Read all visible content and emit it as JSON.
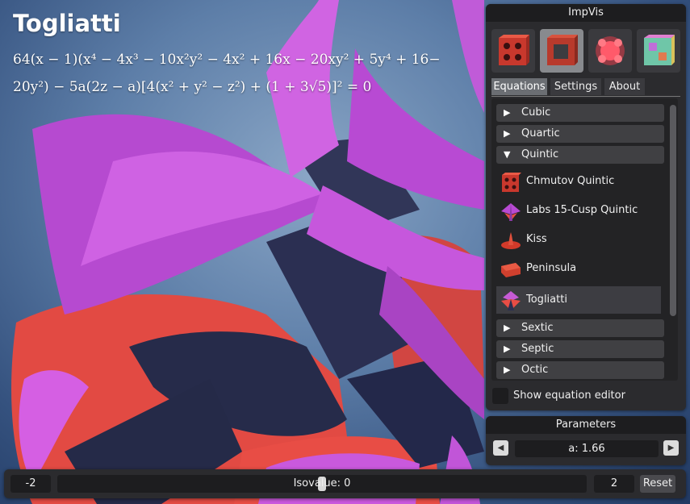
{
  "surface": {
    "title": "Togliatti",
    "equation_line1": "64(x − 1)(x⁴ − 4x³ − 10x²y² − 4x² + 16x − 20xy² + 5y⁴ + 16−",
    "equation_line2": "20y²) − 5a(2z − a)[4(x² + y² − z²) + (1 + 3√5)]² = 0",
    "colors": {
      "outer": "#c65bd6",
      "inner": "#e84d45",
      "background": "#5d7ea8"
    }
  },
  "panel": {
    "title": "ImpVis",
    "thumbnails": [
      {
        "name": "cube-wireframe-red",
        "selected": false
      },
      {
        "name": "cube-wireframe-dark",
        "selected": true
      },
      {
        "name": "glow-blob-red",
        "selected": false
      },
      {
        "name": "cube-rainbow",
        "selected": false
      }
    ],
    "tabs": {
      "equations": "Equations",
      "settings": "Settings",
      "about": "About",
      "active": "Equations"
    },
    "categories": {
      "cubic": "Cubic",
      "quartic": "Quartic",
      "quintic": "Quintic",
      "sextic": "Sextic",
      "septic": "Septic",
      "octic": "Octic"
    },
    "quintic_items": [
      {
        "label": "Chmutov Quintic",
        "icon": "chmutov-icon"
      },
      {
        "label": "Labs 15-Cusp Quintic",
        "icon": "labs-icon"
      },
      {
        "label": "Kiss",
        "icon": "kiss-icon"
      },
      {
        "label": "Peninsula",
        "icon": "peninsula-icon"
      },
      {
        "label": "Togliatti",
        "icon": "togliatti-icon",
        "selected": true
      }
    ],
    "editor_checkbox": {
      "label": "Show equation editor",
      "checked": false
    }
  },
  "parameters": {
    "title": "Parameters",
    "value_text": "a: 1.66",
    "prev_icon": "triangle-left-icon",
    "next_icon": "triangle-right-icon"
  },
  "isovalue": {
    "min_text": "-2",
    "max_text": "2",
    "label": "Isovalue: 0",
    "value": 0,
    "range": [
      -2,
      2
    ],
    "reset_label": "Reset"
  }
}
